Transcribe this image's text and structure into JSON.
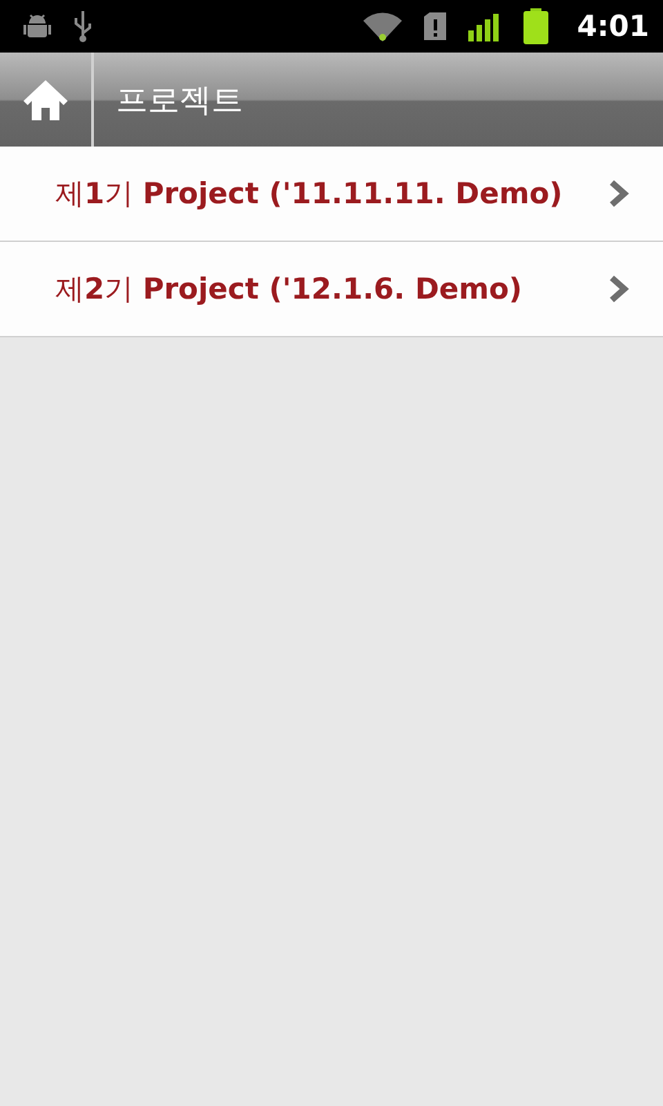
{
  "status_bar": {
    "time": "4:01"
  },
  "header": {
    "title": "프로젝트"
  },
  "items": [
    {
      "label": "제**1**기 **Project ('11.11.11. Demo)**"
    },
    {
      "label": "제**2**기 **Project ('12.1.6. Demo)**"
    }
  ]
}
